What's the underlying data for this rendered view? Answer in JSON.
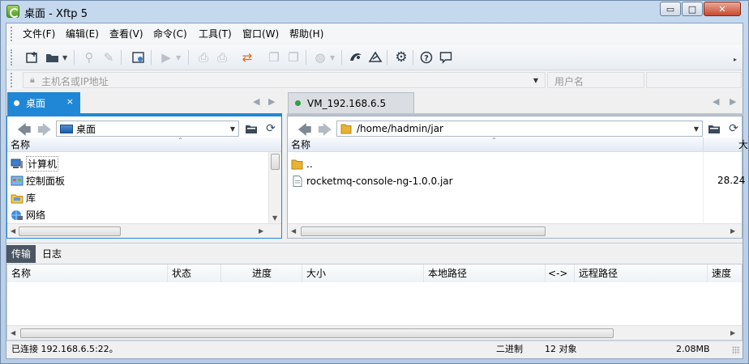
{
  "window": {
    "title": "桌面 - Xftp 5",
    "minimize_glyph": "▭",
    "maximize_glyph": "□",
    "close_glyph": "✕"
  },
  "menu": [
    "文件(F)",
    "编辑(E)",
    "查看(V)",
    "命令(C)",
    "工具(T)",
    "窗口(W)",
    "帮助(H)"
  ],
  "address": {
    "host_placeholder": "主机名或IP地址",
    "user_placeholder": "用户名"
  },
  "left_tab": {
    "label": "桌面",
    "close": "×"
  },
  "right_tab": {
    "label": "VM_192.168.6.5",
    "status_color": "#2ea043"
  },
  "left_pane": {
    "path": "桌面",
    "column_name": "名称",
    "items": [
      {
        "name": "计算机",
        "icon": "computer-icon"
      },
      {
        "name": "控制面板",
        "icon": "control-panel-icon"
      },
      {
        "name": "库",
        "icon": "library-icon"
      },
      {
        "name": "网络",
        "icon": "network-icon"
      }
    ]
  },
  "right_pane": {
    "path": "/home/hadmin/jar",
    "column_name": "名称",
    "column_size_partial": "大",
    "items": [
      {
        "name": "..",
        "icon": "folder-icon",
        "size": ""
      },
      {
        "name": "rocketmq-console-ng-1.0.0.jar",
        "icon": "jar-file-icon",
        "size": "28.24"
      }
    ]
  },
  "transfer": {
    "tabs": [
      "传输",
      "日志"
    ],
    "columns": [
      "名称",
      "状态",
      "进度",
      "大小",
      "本地路径",
      "<->",
      "远程路径",
      "速度"
    ]
  },
  "status": {
    "connection": "已连接 192.168.6.5:22。",
    "mode": "二进制",
    "objects": "12 对象",
    "size": "2.08MB"
  },
  "colors": {
    "accent": "#1f87d6",
    "connected": "#2ea043"
  }
}
